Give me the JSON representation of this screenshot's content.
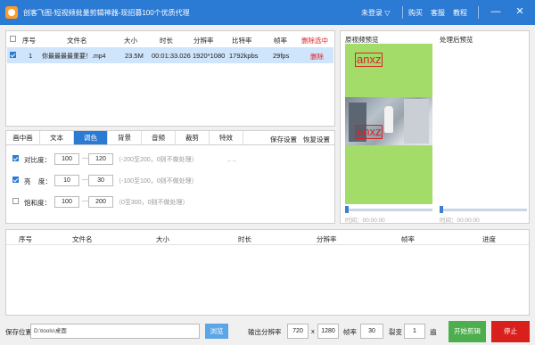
{
  "window": {
    "title": "创客飞图-短视频批量剪辑神器-现招募100个优质代理",
    "login": "未登录",
    "buy": "购买",
    "service": "客服",
    "tutorial": "教程",
    "minimize": "—",
    "close": "✕"
  },
  "file_table": {
    "headers": {
      "index": "序号",
      "name": "文件名",
      "size": "大小",
      "duration": "时长",
      "resolution": "分辨率",
      "bitrate": "比特率",
      "fps": "帧率",
      "delete_selected": "删除选中"
    },
    "rows": [
      {
        "index": "1",
        "name": "你最最最最重要！.mp4",
        "size": "23.5M",
        "duration": "00:01:33.026",
        "resolution": "1920*1080",
        "bitrate": "1792kpbs",
        "fps": "29fps",
        "delete": "删除"
      }
    ]
  },
  "preview": {
    "original_label": "原视频预览",
    "processed_label": "处理后预览",
    "watermark1": "anxz",
    "watermark2": "anxz",
    "time_orig": "时间：00:00:00",
    "time_proc": "时间：00:00:00"
  },
  "tabs": {
    "items": [
      "画中画",
      "文本",
      "调色",
      "背景",
      "音频",
      "裁剪",
      "特效"
    ],
    "active_index": 2,
    "save_settings": "保存设置",
    "restore_settings": "恢复设置"
  },
  "color_options": {
    "contrast": {
      "label": "对比度：",
      "min": "100",
      "max": "120",
      "hint": "（-200至200，0则不做处理）",
      "checked": true
    },
    "brightness": {
      "label": "亮    度：",
      "min": "10",
      "max": "30",
      "hint": "（-100至100，0则不做处理）",
      "checked": true
    },
    "saturation": {
      "label": "饱和度：",
      "min": "100",
      "max": "200",
      "hint": "（0至300，0则不做处理）",
      "checked": false
    },
    "dash": "—",
    "decor": "_ _"
  },
  "task_table": {
    "headers": {
      "index": "序号",
      "name": "文件名",
      "size": "大小",
      "duration": "时长",
      "resolution": "分辨率",
      "fps": "帧率",
      "progress": "进度"
    }
  },
  "bottom": {
    "save_label": "保存位置",
    "save_path": "D:\\tools\\桌面",
    "browse": "浏览",
    "output_res_label": "输出分辨率",
    "width": "720",
    "x": "x",
    "height": "1280",
    "fps_label": "帧率",
    "fps": "30",
    "split_label": "裂变",
    "split_count": "1",
    "split_unit": "遍",
    "start": "开始剪辑",
    "stop": "停止"
  },
  "colors": {
    "accent": "#2b7ad3",
    "delete_red": "#e02020",
    "start_green": "#4cae4c",
    "stop_red": "#d9201c"
  }
}
